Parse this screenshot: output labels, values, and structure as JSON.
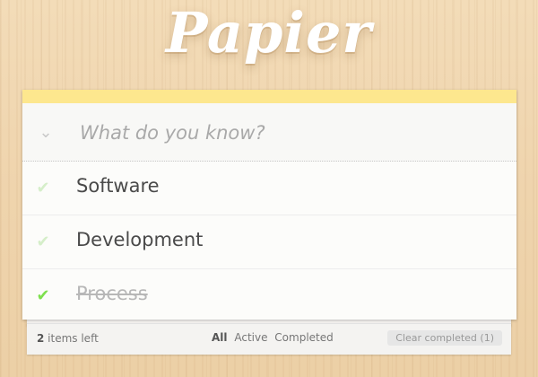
{
  "app": {
    "title": "Papier"
  },
  "new_todo": {
    "placeholder": "What do you know?",
    "toggle_icon": "chevron-double-down-icon"
  },
  "todos": [
    {
      "label": "Software",
      "completed": false
    },
    {
      "label": "Development",
      "completed": false
    },
    {
      "label": "Process",
      "completed": true
    }
  ],
  "footer": {
    "count": "2",
    "count_suffix": " items left",
    "filters": [
      "All",
      "Active",
      "Completed"
    ],
    "selected_filter": "All",
    "clear_label": "Clear completed (1)"
  },
  "colors": {
    "check_active": "#7ee04e",
    "check_inactive": "#d5eec9",
    "top_bar": "#fde78e"
  }
}
